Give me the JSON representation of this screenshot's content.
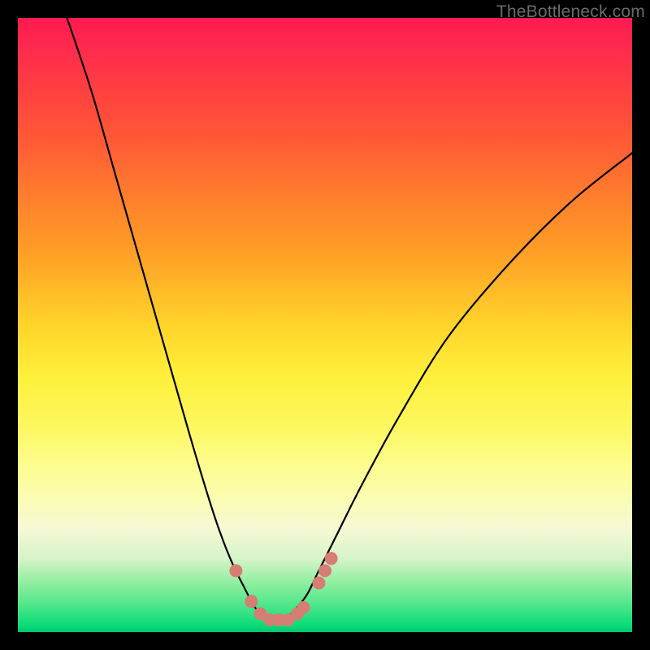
{
  "watermark": {
    "text": "TheBottleneck.com"
  },
  "colors": {
    "background": "#000000",
    "curve": "#000000",
    "markers": "#d67d74",
    "gradient_top": "#ff1a50",
    "gradient_bottom": "#02c46e"
  },
  "chart_data": {
    "type": "line",
    "title": "",
    "xlabel": "",
    "ylabel": "",
    "xlim": [
      0,
      100
    ],
    "ylim": [
      0,
      100
    ],
    "grid": false,
    "legend": false,
    "series": [
      {
        "name": "bottleneck-curve",
        "x": [
          8,
          12,
          16,
          20,
          24,
          28,
          31,
          33,
          35,
          37,
          38,
          39,
          40,
          41,
          42,
          43,
          44,
          45,
          47,
          49,
          52,
          56,
          62,
          70,
          80,
          90,
          100
        ],
        "y": [
          100,
          88,
          74,
          60,
          46,
          32,
          22,
          16,
          11,
          7,
          5,
          3.5,
          2.5,
          2,
          2,
          2,
          2.5,
          3.5,
          6,
          10,
          16,
          24,
          35,
          48,
          60,
          70,
          78
        ]
      }
    ],
    "markers": {
      "name": "highlight-points",
      "x": [
        35.5,
        38,
        39.5,
        41,
        42.5,
        44,
        45.5,
        46.5,
        49,
        50,
        51
      ],
      "y": [
        10,
        5,
        3,
        2,
        2,
        2,
        3,
        4,
        8,
        10,
        12
      ]
    }
  }
}
